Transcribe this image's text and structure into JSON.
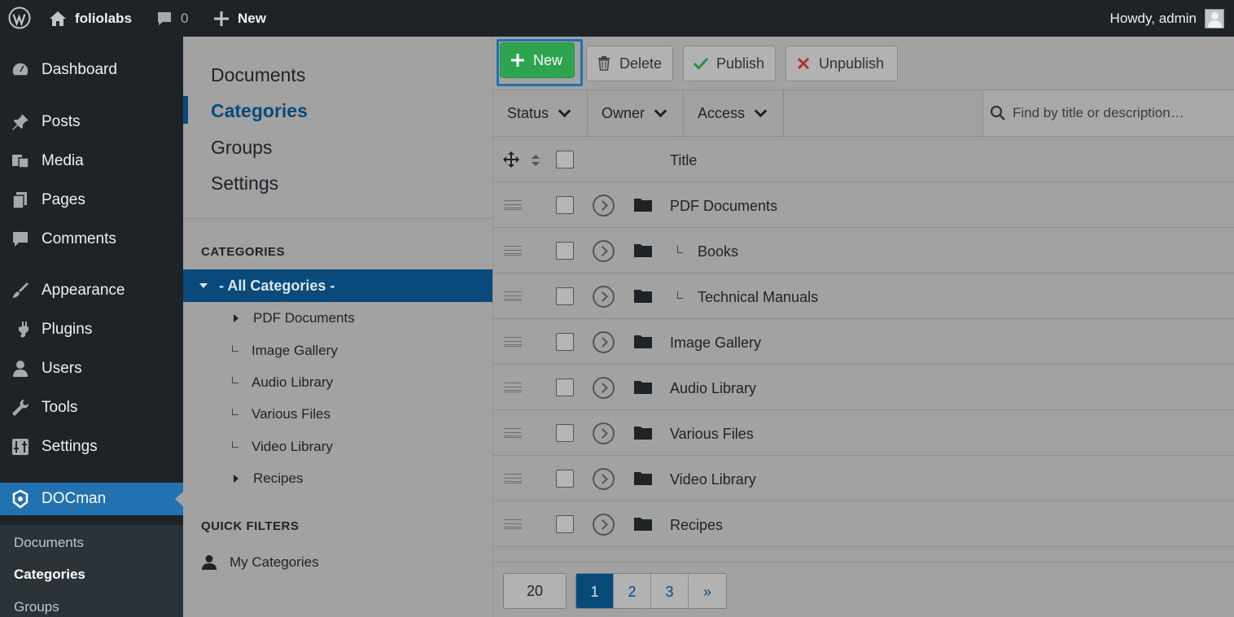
{
  "adminbar": {
    "site_name": "foliolabs",
    "comments_count": "0",
    "new_label": "New",
    "howdy": "Howdy, admin"
  },
  "adminmenu": {
    "items": [
      {
        "label": "Dashboard",
        "icon": "dashboard-icon"
      },
      {
        "label": "Posts",
        "icon": "pin-icon"
      },
      {
        "label": "Media",
        "icon": "media-icon"
      },
      {
        "label": "Pages",
        "icon": "pages-icon"
      },
      {
        "label": "Comments",
        "icon": "comment-icon"
      },
      {
        "label": "Appearance",
        "icon": "brush-icon"
      },
      {
        "label": "Plugins",
        "icon": "plugin-icon"
      },
      {
        "label": "Users",
        "icon": "user-icon"
      },
      {
        "label": "Tools",
        "icon": "wrench-icon"
      },
      {
        "label": "Settings",
        "icon": "settings-icon"
      },
      {
        "label": "DOCman",
        "icon": "docman-icon"
      }
    ],
    "submenu": [
      "Documents",
      "Categories",
      "Groups"
    ]
  },
  "docnav": {
    "items": [
      "Documents",
      "Categories",
      "Groups",
      "Settings"
    ],
    "categories_title": "CATEGORIES",
    "all_categories": "- All Categories -",
    "tree": [
      "PDF Documents",
      "Image Gallery",
      "Audio Library",
      "Various Files",
      "Video Library",
      "Recipes"
    ],
    "quick_filters_title": "QUICK FILTERS",
    "my_categories": "My Categories"
  },
  "toolbar": {
    "new_label": "New",
    "delete_label": "Delete",
    "publish_label": "Publish",
    "unpublish_label": "Unpublish"
  },
  "filters": {
    "status": "Status",
    "owner": "Owner",
    "access": "Access",
    "search_placeholder": "Find by title or description…"
  },
  "table": {
    "title_header": "Title",
    "rows": [
      "PDF Documents",
      "Books",
      "Technical Manuals",
      "Image Gallery",
      "Audio Library",
      "Various Files",
      "Video Library",
      "Recipes"
    ]
  },
  "pagination": {
    "per_page": "20",
    "pages": [
      "1",
      "2",
      "3",
      "»"
    ]
  }
}
